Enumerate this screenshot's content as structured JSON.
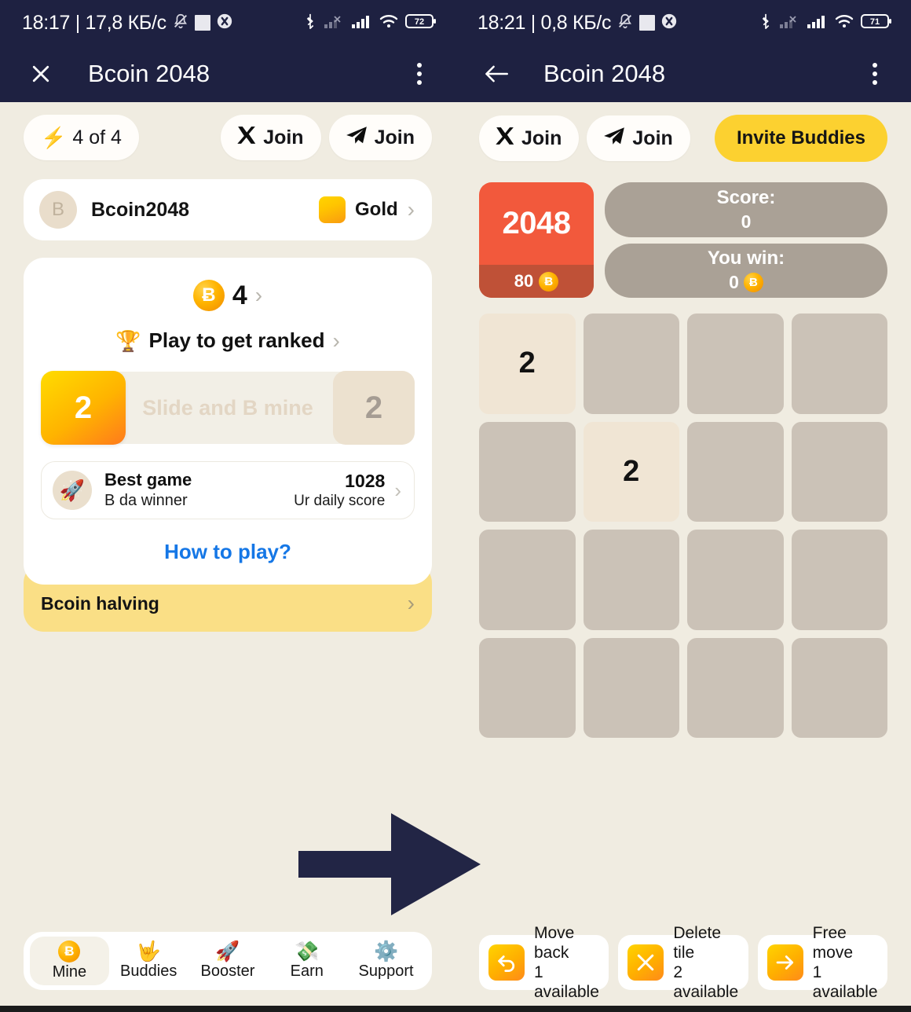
{
  "left": {
    "statusbar": {
      "clock": "18:17 | 17,8 КБ/с",
      "icons": [
        "bell-muted-icon",
        "square-icon",
        "circle-x-icon"
      ],
      "right_icons": [
        "bluetooth-icon",
        "signal-off-icon",
        "signal-icon",
        "wifi-icon"
      ],
      "battery": "72"
    },
    "titlebar": {
      "nav_icon": "close-icon",
      "title": "Bcoin 2048",
      "menu_icon": "kebab-menu-icon"
    },
    "energy": {
      "icon": "lightning-icon",
      "label": "4 of 4"
    },
    "joins": [
      {
        "icon": "x-twitter-icon",
        "label": "Join"
      },
      {
        "icon": "telegram-icon",
        "label": "Join"
      }
    ],
    "profile": {
      "avatar_letter": "B",
      "username": "Bcoin2048",
      "rank_label": "Gold",
      "chevron": "›"
    },
    "balance": {
      "coin_symbol": "Ƀ",
      "amount": "4",
      "chevron": "›"
    },
    "ranked": {
      "icon": "🏆",
      "label": "Play to get ranked",
      "chevron": "›"
    },
    "slider": {
      "left_tile": "2",
      "text": "Slide and B mine",
      "right_tile": "2"
    },
    "bestgame": {
      "icon": "🚀",
      "title": "Best game",
      "subtitle": "B da winner",
      "score": "1028",
      "score_label": "Ur daily score",
      "chevron": "›"
    },
    "how_to_play": "How to play?",
    "halving": {
      "label": "Bcoin halving",
      "chevron": "›"
    },
    "bottomnav": [
      {
        "icon": "bcoin-icon",
        "glyph": "Ƀ",
        "label": "Mine",
        "active": true
      },
      {
        "icon": "hand-horns-icon",
        "glyph": "🤟",
        "label": "Buddies",
        "active": false
      },
      {
        "icon": "rocket-icon",
        "glyph": "🚀",
        "label": "Booster",
        "active": false
      },
      {
        "icon": "money-wings-icon",
        "glyph": "💸",
        "label": "Earn",
        "active": false
      },
      {
        "icon": "gear-icon",
        "glyph": "⚙️",
        "label": "Support",
        "active": false
      }
    ]
  },
  "right": {
    "statusbar": {
      "clock": "18:21 | 0,8 КБ/с",
      "icons": [
        "bell-muted-icon",
        "square-icon",
        "circle-x-icon"
      ],
      "right_icons": [
        "bluetooth-icon",
        "signal-off-icon",
        "signal-icon",
        "wifi-icon"
      ],
      "battery": "71"
    },
    "titlebar": {
      "nav_icon": "back-arrow-icon",
      "title": "Bcoin 2048",
      "menu_icon": "kebab-menu-icon"
    },
    "joins": [
      {
        "icon": "x-twitter-icon",
        "label": "Join"
      },
      {
        "icon": "telegram-icon",
        "label": "Join"
      }
    ],
    "invite_label": "Invite Buddies",
    "logo": {
      "title": "2048",
      "reward": "80",
      "coin_symbol": "Ƀ"
    },
    "score": {
      "key": "Score:",
      "value": "0"
    },
    "youwin": {
      "key": "You win:",
      "value": "0",
      "coin_symbol": "Ƀ"
    },
    "board": [
      [
        "2",
        "",
        "",
        ""
      ],
      [
        "",
        "2",
        "",
        ""
      ],
      [
        "",
        "",
        "",
        ""
      ],
      [
        "",
        "",
        "",
        ""
      ]
    ],
    "actions": [
      {
        "icon": "undo-arrow-icon",
        "title": "Move back",
        "sub": "1 available"
      },
      {
        "icon": "x-cross-icon",
        "title": "Delete tile",
        "sub": "2 available"
      },
      {
        "icon": "right-arrow-icon",
        "title": "Free move",
        "sub": "1 available"
      }
    ]
  },
  "annotation": {
    "arrow": "right-arrow-annotation",
    "color": "#222545"
  },
  "colors": {
    "background": "#f0ece1",
    "header": "#1e2141",
    "accent_yellow": "#fcd130",
    "tile_empty": "#cbc2b7",
    "tile_two": "#f0e5d4",
    "logo_red": "#f2593c",
    "score_gray": "#aaa196",
    "link_blue": "#1577e6",
    "halving_yellow": "#fadf86"
  }
}
